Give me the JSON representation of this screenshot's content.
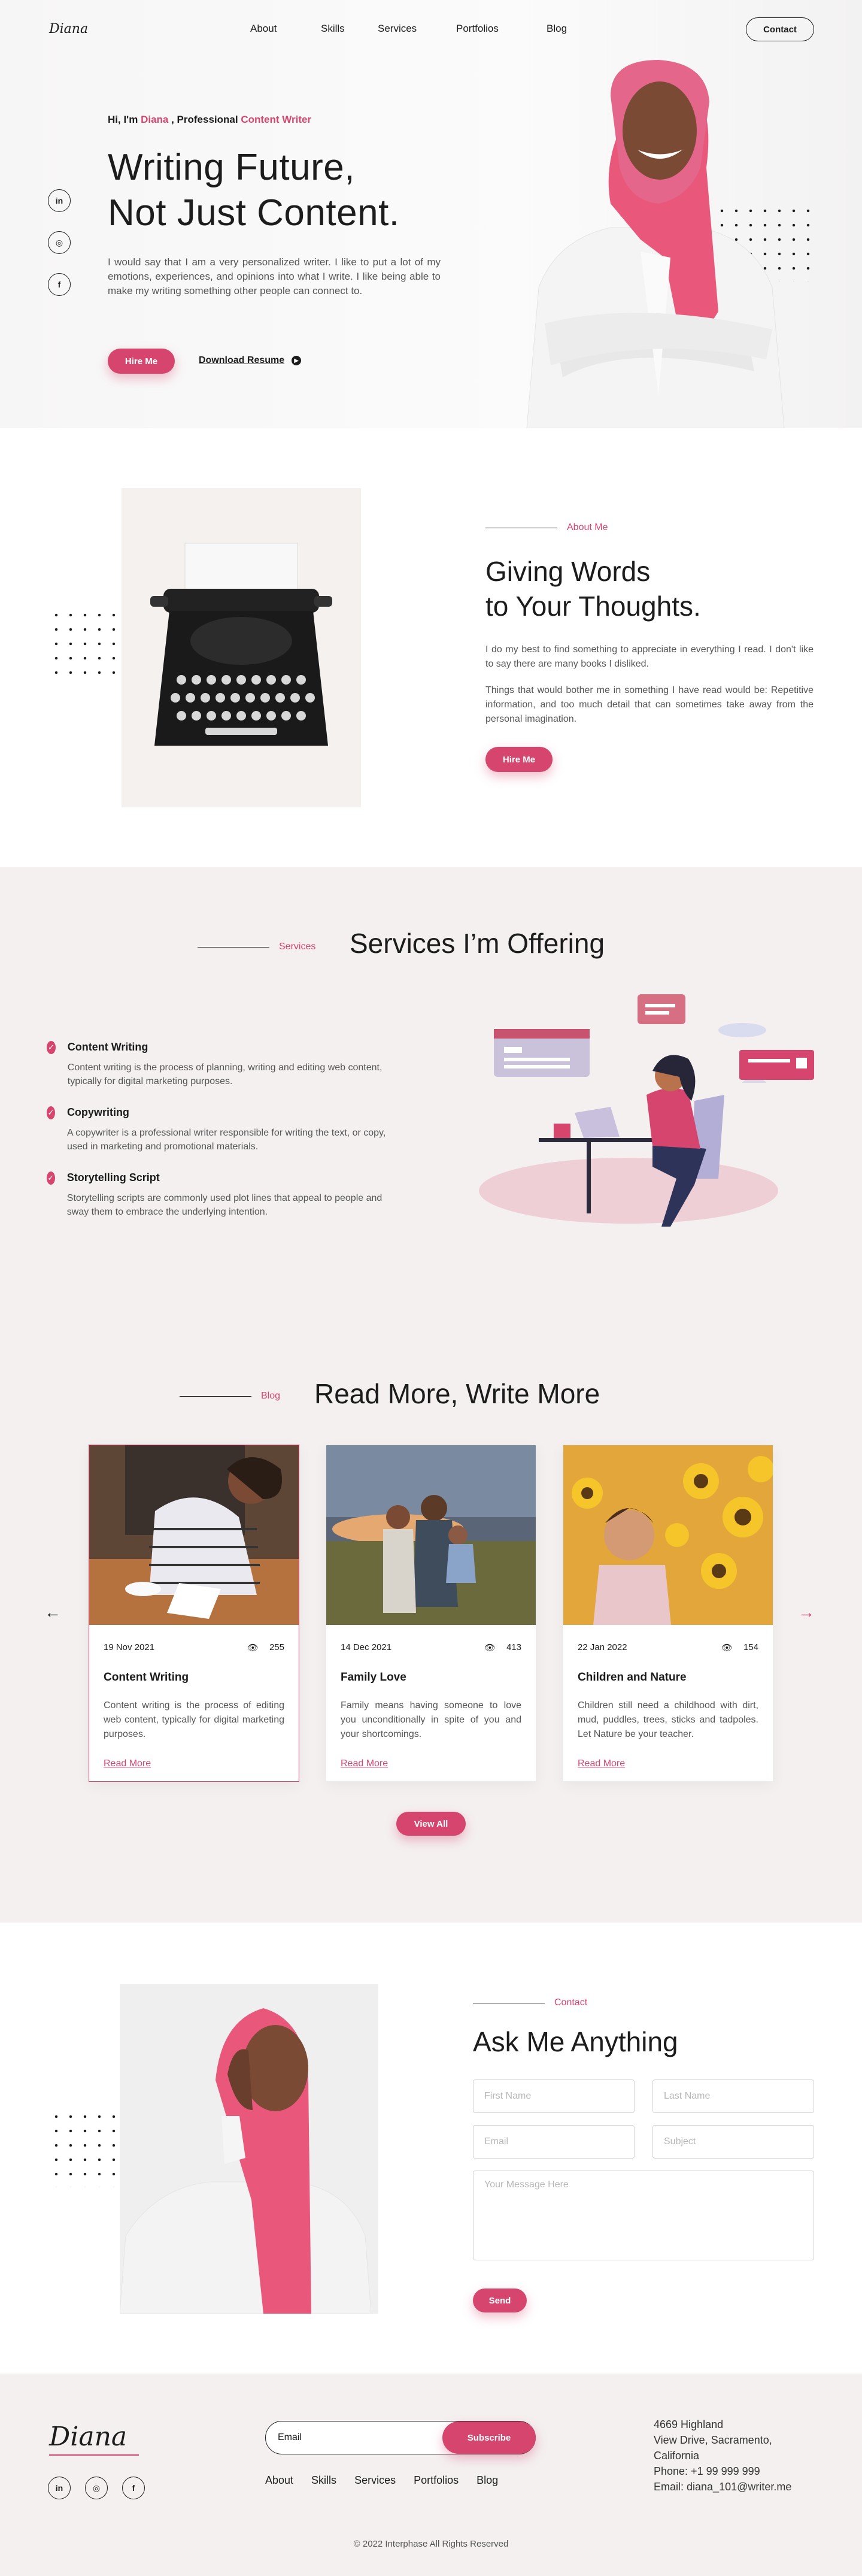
{
  "brand": "Diana",
  "nav": {
    "items": [
      "About",
      "Skills",
      "Services",
      "Portfolios",
      "Blog"
    ],
    "contact": "Contact"
  },
  "hero": {
    "greet_prefix": "Hi, I'm",
    "greet_name": "Diana",
    "greet_mid": ", Professional",
    "greet_role": "Content Writer",
    "title_line1": "Writing Future,",
    "title_line2": "Not Just Content.",
    "desc": "I would say that I am a very personalized writer. I like to put a lot of my emotions, experiences, and opinions into what I write. I like being able to make my writing something other people can connect to.",
    "hire": "Hire Me",
    "download": "Download Resume",
    "socials": [
      "in",
      "◎",
      "f"
    ]
  },
  "about": {
    "label": "About Me",
    "title_line1": "Giving Words",
    "title_line2": "to Your Thoughts.",
    "p1": "I do my best to find something to appreciate in everything I read. I don't like to say there are many books I disliked.",
    "p2": "Things that would bother me in something I have read would be: Repetitive information, and too much detail that can sometimes take away from the personal imagination.",
    "hire": "Hire Me"
  },
  "services": {
    "label": "Services",
    "title": "Services I’m Offering",
    "items": [
      {
        "title": "Content Writing",
        "desc": "Content writing is the process of planning, writing and editing web content, typically for digital marketing purposes."
      },
      {
        "title": "Copywriting",
        "desc": "A copywriter is a professional writer responsible for writing the text, or copy, used in marketing and promotional materials."
      },
      {
        "title": "Storytelling Script",
        "desc": "Storytelling scripts are commonly used plot lines that appeal to people and sway them to embrace the underlying intention."
      }
    ]
  },
  "blog": {
    "label": "Blog",
    "title": "Read More, Write More",
    "cards": [
      {
        "date": "19 Nov 2021",
        "views": "255",
        "title": "Content Writing",
        "desc": "Content writing is the process of editing web content, typically for digital marketing purposes.",
        "link": "Read More"
      },
      {
        "date": "14 Dec 2021",
        "views": "413",
        "title": "Family Love",
        "desc": "Family means having someone to love you unconditionally in spite of you and your shortcomings.",
        "link": "Read More"
      },
      {
        "date": "22 Jan 2022",
        "views": "154",
        "title": "Children and Nature",
        "desc": "Children still need a childhood with dirt, mud, puddles, trees, sticks and tadpoles. Let Nature be your teacher.",
        "link": "Read More"
      }
    ],
    "view_all": "View All"
  },
  "contact": {
    "label": "Contact",
    "title": "Ask Me Anything",
    "first": "First Name",
    "last": "Last Name",
    "email": "Email",
    "subject": "Subject",
    "message": "Your Message Here",
    "send": "Send"
  },
  "footer": {
    "email_placeholder": "Email",
    "subscribe": "Subscribe",
    "links": [
      "About",
      "Skills",
      "Services",
      "Portfolios",
      "Blog"
    ],
    "address1": "4669 Highland",
    "address2": "View Drive, Sacramento,",
    "address3": "California",
    "phone": "Phone: +1 99 999 999",
    "email": "Email: diana_101@writer.me",
    "copyright": "© 2022 Interphase All Rights Reserved"
  },
  "colors": {
    "accent": "#d6456e",
    "text": "#1c1c1c",
    "section_bg": "#f4f0f0"
  }
}
